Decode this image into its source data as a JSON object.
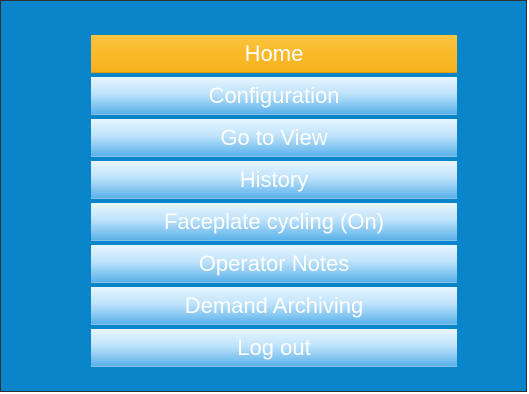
{
  "menu": {
    "items": [
      {
        "label": "Home",
        "active": true
      },
      {
        "label": "Configuration",
        "active": false
      },
      {
        "label": "Go to View",
        "active": false
      },
      {
        "label": "History",
        "active": false
      },
      {
        "label": "Faceplate cycling (On)",
        "active": false
      },
      {
        "label": "Operator Notes",
        "active": false
      },
      {
        "label": "Demand Archiving",
        "active": false
      },
      {
        "label": "Log out",
        "active": false
      }
    ]
  },
  "colors": {
    "background": "#0a85c9",
    "active_item": "#f6b21b",
    "item_top": "#e8f6ff",
    "item_bottom": "#5bb1ea",
    "text": "#ffffff"
  }
}
